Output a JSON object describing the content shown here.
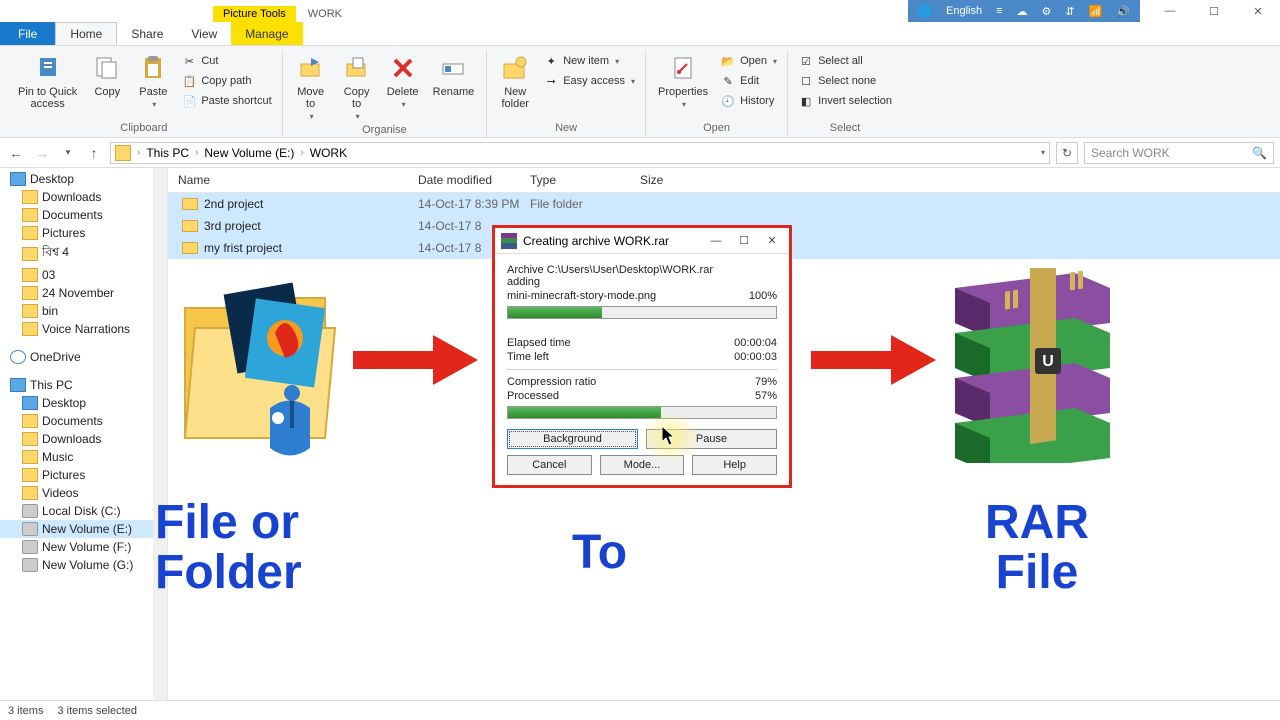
{
  "window": {
    "picture_tools": "Picture Tools",
    "folder_title": "WORK",
    "lang_panel": {
      "globe": "🌐",
      "lang": "English",
      "icons": [
        "≡",
        "☁",
        "⚙",
        "⇵",
        "📶",
        "🔊"
      ]
    },
    "controls": {
      "min": "—",
      "max": "☐",
      "close": "✕"
    }
  },
  "tabs": {
    "file": "File",
    "home": "Home",
    "share": "Share",
    "view": "View",
    "manage": "Manage"
  },
  "ribbon": {
    "clipboard": {
      "label": "Clipboard",
      "pin": "Pin to Quick\naccess",
      "copy": "Copy",
      "paste": "Paste",
      "cut": "Cut",
      "copy_path": "Copy path",
      "paste_shortcut": "Paste shortcut"
    },
    "organise": {
      "label": "Organise",
      "move_to": "Move\nto",
      "copy_to": "Copy\nto",
      "delete": "Delete",
      "rename": "Rename"
    },
    "new": {
      "label": "New",
      "new_folder": "New\nfolder",
      "new_item": "New item",
      "easy_access": "Easy access"
    },
    "open": {
      "label": "Open",
      "properties": "Properties",
      "open": "Open",
      "edit": "Edit",
      "history": "History"
    },
    "select": {
      "label": "Select",
      "select_all": "Select all",
      "select_none": "Select none",
      "invert": "Invert selection"
    }
  },
  "address": {
    "crumbs": [
      "This PC",
      "New Volume (E:)",
      "WORK"
    ],
    "refresh": "↻",
    "search_placeholder": "Search WORK"
  },
  "sidebar": {
    "items": [
      {
        "label": "Desktop",
        "type": "desk",
        "top": true
      },
      {
        "label": "Downloads",
        "type": "folder"
      },
      {
        "label": "Documents",
        "type": "folder"
      },
      {
        "label": "Pictures",
        "type": "folder"
      },
      {
        "label": "বিশ্ব 4",
        "type": "folder"
      },
      {
        "label": "03",
        "type": "folder"
      },
      {
        "label": "24 November",
        "type": "folder"
      },
      {
        "label": "bin",
        "type": "folder"
      },
      {
        "label": "Voice Narrations",
        "type": "folder"
      },
      {
        "label": "OneDrive",
        "type": "cloud",
        "top": true,
        "spaced": true
      },
      {
        "label": "This PC",
        "type": "desk",
        "top": true,
        "spaced": true
      },
      {
        "label": "Desktop",
        "type": "desk"
      },
      {
        "label": "Documents",
        "type": "folder"
      },
      {
        "label": "Downloads",
        "type": "folder"
      },
      {
        "label": "Music",
        "type": "folder"
      },
      {
        "label": "Pictures",
        "type": "folder"
      },
      {
        "label": "Videos",
        "type": "folder"
      },
      {
        "label": "Local Disk (C:)",
        "type": "disk"
      },
      {
        "label": "New Volume (E:)",
        "type": "disk",
        "sel": true
      },
      {
        "label": "New Volume (F:)",
        "type": "disk"
      },
      {
        "label": "New Volume (G:)",
        "type": "disk"
      }
    ]
  },
  "columns": {
    "name": "Name",
    "date": "Date modified",
    "type": "Type",
    "size": "Size"
  },
  "rows": [
    {
      "name": "2nd project",
      "date": "14-Oct-17 8:39 PM",
      "type": "File folder",
      "sel": true
    },
    {
      "name": "3rd project",
      "date": "14-Oct-17 8",
      "type": "",
      "sel": true
    },
    {
      "name": "my frist project",
      "date": "14-Oct-17 8",
      "type": "",
      "sel": true
    }
  ],
  "dialog": {
    "title": "Creating archive WORK.rar",
    "archive_path": "Archive C:\\Users\\User\\Desktop\\WORK.rar",
    "action": "adding",
    "current_file": "mini-minecraft-story-mode.png",
    "file_pct": "100%",
    "file_progress": 35,
    "elapsed_label": "Elapsed time",
    "elapsed": "00:00:04",
    "left_label": "Time left",
    "left": "00:00:03",
    "ratio_label": "Compression ratio",
    "ratio": "79%",
    "processed_label": "Processed",
    "processed": "57%",
    "proc_progress": 57,
    "buttons": {
      "background": "Background",
      "pause": "Pause",
      "cancel": "Cancel",
      "mode": "Mode...",
      "help": "Help"
    }
  },
  "captions": {
    "left": "File or\nFolder",
    "mid": "To",
    "right": "RAR\nFile"
  },
  "status": {
    "items": "3 items",
    "selected": "3 items selected"
  }
}
